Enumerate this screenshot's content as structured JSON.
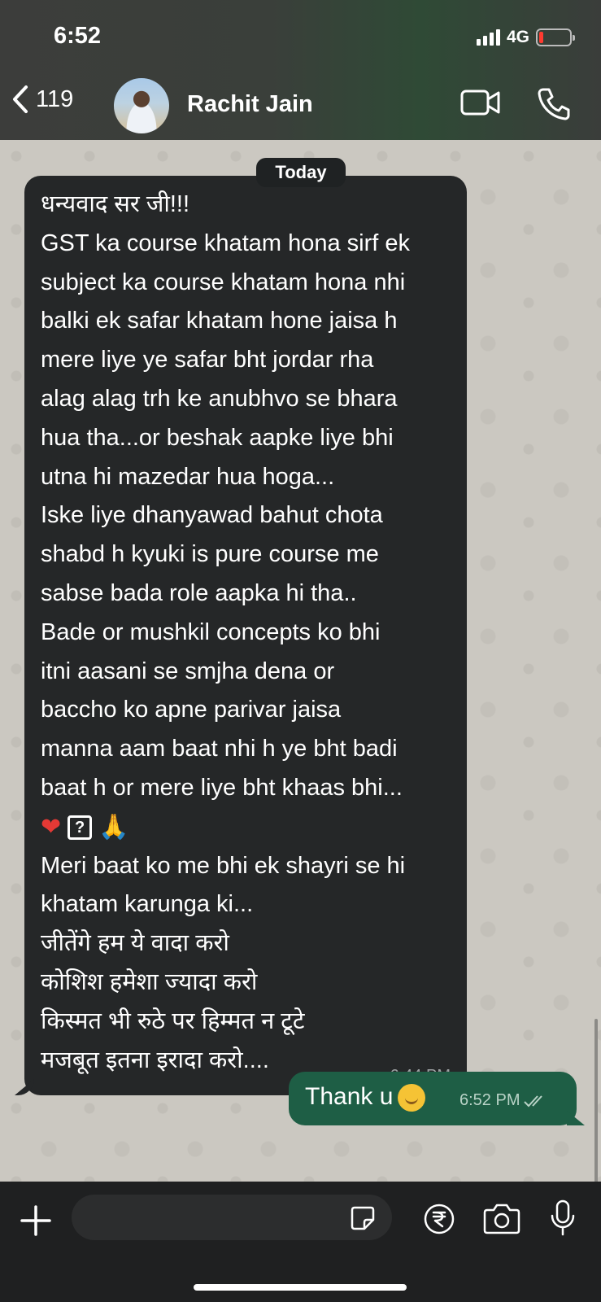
{
  "status_bar": {
    "time": "6:52",
    "network": "4G",
    "battery_level_percent": 15,
    "battery_color": "#ff3b30"
  },
  "header": {
    "back_count": "119",
    "contact_name": "Rachit Jain",
    "icons": [
      "chevron-left-icon",
      "video-call-icon",
      "phone-icon"
    ]
  },
  "chat": {
    "date_label": "Today",
    "incoming": {
      "lines_before_emoji": [
        "धन्यवाद सर जी!!!",
        "GST ka course khatam hona sirf ek",
        "subject ka course khatam hona nhi",
        "balki ek safar khatam hone jaisa h",
        "mere liye ye safar bht jordar rha",
        "alag alag trh ke anubhvo se bhara",
        "hua tha...or beshak aapke liye bhi",
        "utna hi mazedar hua hoga...",
        "Iske liye dhanyawad bahut chota",
        "shabd h kyuki is pure course me",
        "sabse bada role aapka hi tha..",
        "Bade or mushkil concepts ko bhi",
        "itni aasani se smjha dena or",
        "baccho ko apne parivar jaisa",
        "manna aam baat nhi h ye bht badi",
        "baat h or mere liye bht khaas bhi..."
      ],
      "emojis": {
        "heart": "❤",
        "unknown": "?",
        "pray": "🙏"
      },
      "lines_after_emoji": [
        "Meri baat ko me bhi ek shayri se hi",
        "khatam karunga ki...",
        "जीतेंगे हम ये वादा करो",
        "कोशिश हमेशा ज्यादा करो",
        "किस्मत भी रुठे पर हिम्मत न टूटे",
        "मजबूत इतना इरादा करो...."
      ],
      "time": "6:44 PM"
    },
    "outgoing": {
      "text": "Thank u",
      "time": "6:52 PM",
      "status": "read"
    }
  },
  "input_bar": {
    "placeholder": "",
    "icons": [
      "plus-icon",
      "sticker-icon",
      "rupee-icon",
      "camera-icon",
      "microphone-icon"
    ]
  },
  "colors": {
    "incoming_bubble": "#252728",
    "outgoing_bubble": "#1e5e45",
    "chat_background": "#cbc8c1"
  }
}
